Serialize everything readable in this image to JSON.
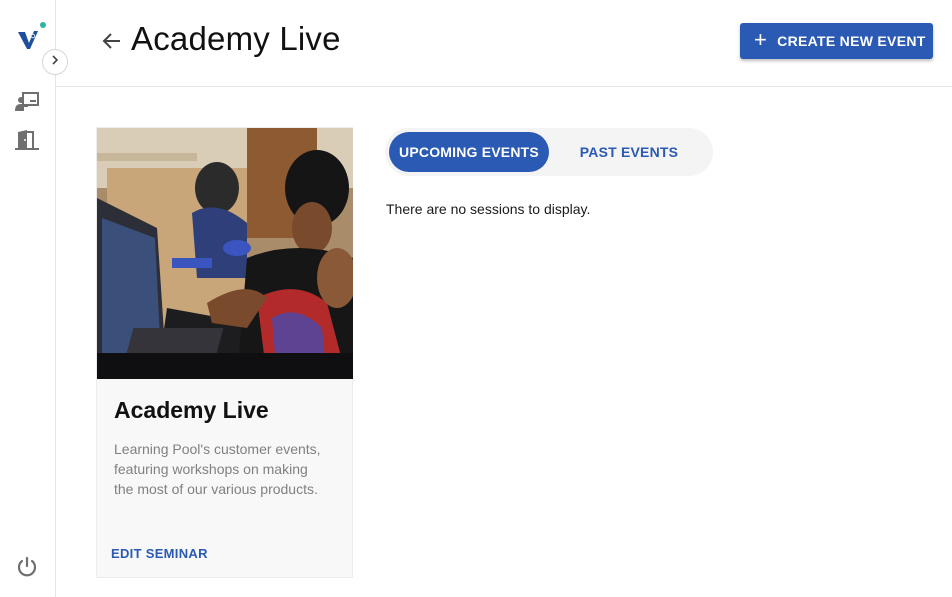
{
  "sidebar": {
    "items": [
      {
        "icon": "presenter-icon",
        "label": ""
      },
      {
        "icon": "door-exit-icon",
        "label": ""
      }
    ],
    "logout_icon": "power-icon",
    "expand_icon": "chevron-right-icon",
    "brand_colors": {
      "logo_blue": "#1f4f9c",
      "logo_teal": "#2bb5a0"
    }
  },
  "header": {
    "title": "Academy Live",
    "create_button_label": "CREATE NEW EVENT"
  },
  "card": {
    "title": "Academy Live",
    "description_lines": [
      "Learning Pool's customer events,",
      "featuring workshops on making",
      "the most of our various products."
    ],
    "edit_label": "EDIT SEMINAR"
  },
  "tabs": [
    {
      "label": "UPCOMING EVENTS",
      "active": true
    },
    {
      "label": "PAST EVENTS",
      "active": false
    }
  ],
  "empty_message": "There are no sessions to display.",
  "colors": {
    "accent": "#2a5ab3",
    "muted_text": "#808080"
  }
}
